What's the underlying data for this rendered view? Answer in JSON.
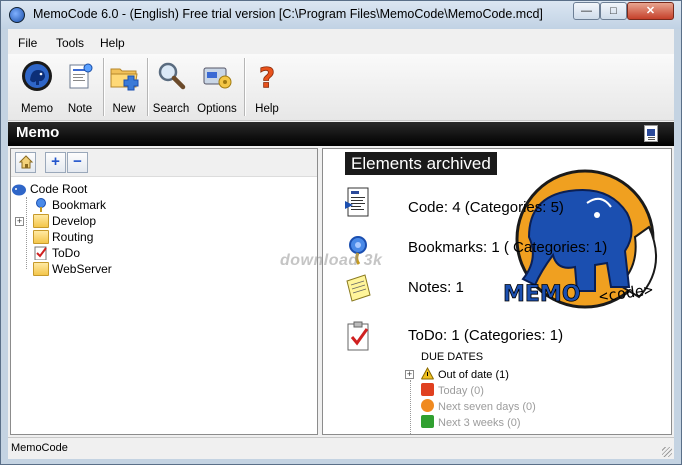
{
  "window": {
    "title": "MemoCode 6.0 - (English) Free trial version  [C:\\Program Files\\MemoCode\\MemoCode.mcd]",
    "controls": {
      "minimize": "—",
      "maximize": "□",
      "close": "✕"
    }
  },
  "menu": [
    "File",
    "Tools",
    "Help"
  ],
  "toolbar": [
    {
      "label": "Memo",
      "icon": "memo-elephant-icon"
    },
    {
      "label": "Note",
      "icon": "note-icon"
    },
    {
      "label": "New",
      "icon": "new-folder-icon"
    },
    {
      "label": "Search",
      "icon": "magnifier-icon"
    },
    {
      "label": "Options",
      "icon": "options-icon"
    },
    {
      "label": "Help",
      "icon": "help-icon"
    }
  ],
  "header": {
    "title": "Memo"
  },
  "left_toolbar": {
    "add": "+",
    "remove": "−"
  },
  "tree": {
    "root": "Code Root",
    "children": [
      "Bookmark",
      "Develop",
      "Routing",
      "ToDo",
      "WebServer"
    ]
  },
  "right": {
    "title": "Elements archived",
    "rows": [
      {
        "text": "Code: 4 (Categories: 5)",
        "icon": "code-document-icon"
      },
      {
        "text": "Bookmarks: 1 ( Categories: 1)",
        "icon": "bookmark-pin-icon"
      },
      {
        "text": "Notes: 1",
        "icon": "sticky-note-icon"
      },
      {
        "text": "ToDo: 1 (Categories: 1)",
        "icon": "todo-clipboard-icon"
      }
    ],
    "due": {
      "title": "DUE DATES",
      "items": [
        {
          "text": "Out of date  (1)",
          "icon": "warning-icon",
          "color": "#f0c020"
        },
        {
          "text": "Today  (0)",
          "icon": "up-arrow-red-icon",
          "color": "#e04020"
        },
        {
          "text": "Next seven days  (0)",
          "icon": "orange-circle-icon",
          "color": "#f08a20"
        },
        {
          "text": "Next 3 weeks  (0)",
          "icon": "green-check-icon",
          "color": "#30a030"
        }
      ]
    },
    "logo": {
      "word": "MEMO",
      "tag": "<code>"
    }
  },
  "watermark": "download 3k",
  "status": "MemoCode",
  "colors": {
    "header_bg": "#000000",
    "elephant_blue": "#1b4fb0",
    "logo_orange": "#f0a020"
  }
}
